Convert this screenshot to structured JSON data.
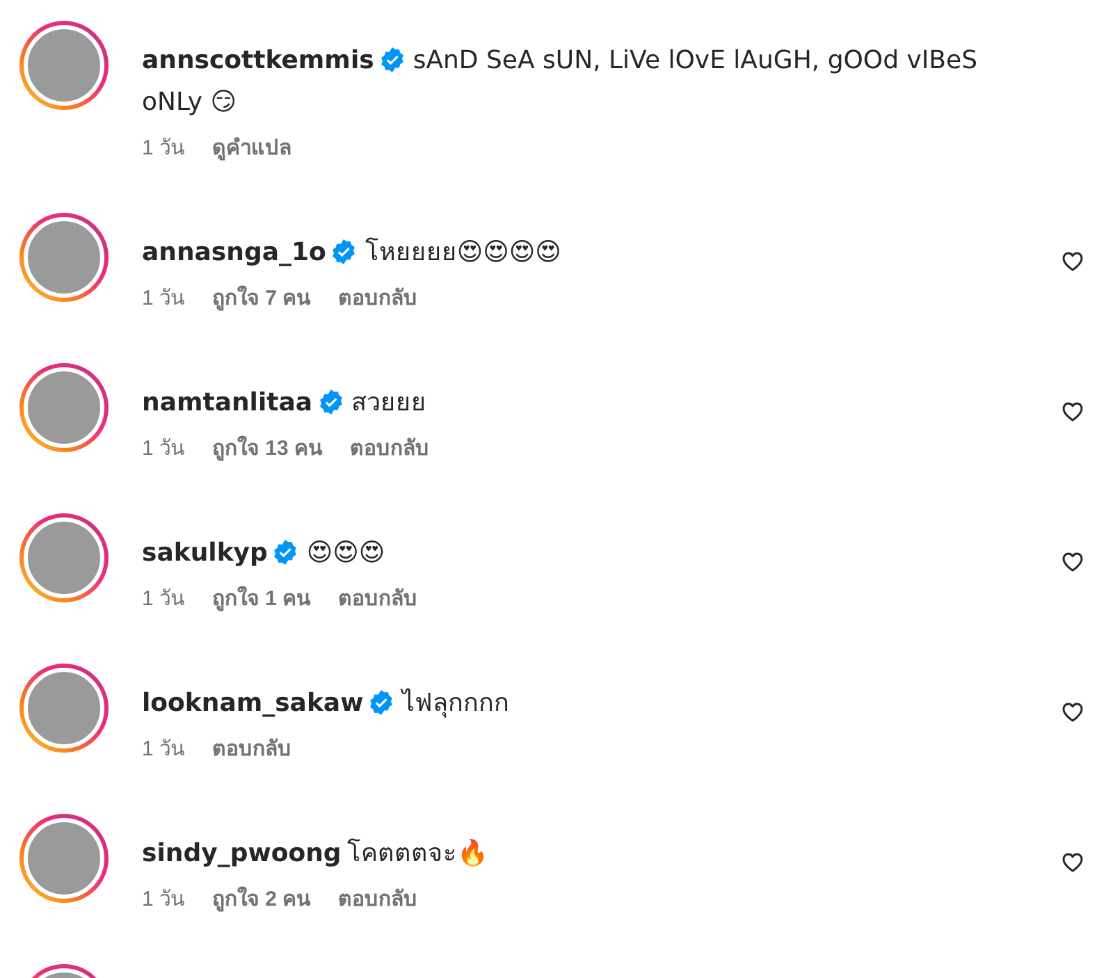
{
  "comments": [
    {
      "kind": "comment",
      "username": "annscottkemmis",
      "verified": true,
      "text": "sAnD SeA sUN, LiVe lOvE lAuGH, gOOd vIBeS oNLy 😏",
      "has_like": false,
      "meta": [
        {
          "kind": "time",
          "text": "1 วัน"
        },
        {
          "kind": "action",
          "text": "ดูคำแปล"
        }
      ]
    },
    {
      "kind": "comment",
      "username": "annasnga_1o",
      "verified": true,
      "text": "โหยยยย😍😍😍😍",
      "has_like": true,
      "liked": false,
      "meta": [
        {
          "kind": "time",
          "text": "1 วัน"
        },
        {
          "kind": "likes",
          "text": "ถูกใจ 7 คน"
        },
        {
          "kind": "action",
          "text": "ตอบกลับ"
        }
      ]
    },
    {
      "kind": "comment",
      "username": "namtanlitaa",
      "verified": true,
      "text": "สวยยย",
      "has_like": true,
      "liked": false,
      "meta": [
        {
          "kind": "time",
          "text": "1 วัน"
        },
        {
          "kind": "likes",
          "text": "ถูกใจ 13 คน"
        },
        {
          "kind": "action",
          "text": "ตอบกลับ"
        }
      ]
    },
    {
      "kind": "comment",
      "username": "sakulkyp",
      "verified": true,
      "text": "😍😍😍",
      "has_like": true,
      "liked": false,
      "meta": [
        {
          "kind": "time",
          "text": "1 วัน"
        },
        {
          "kind": "likes",
          "text": "ถูกใจ 1 คน"
        },
        {
          "kind": "action",
          "text": "ตอบกลับ"
        }
      ]
    },
    {
      "kind": "comment",
      "username": "looknam_sakaw",
      "verified": true,
      "text": "ไฟลุกกกก",
      "has_like": true,
      "liked": false,
      "meta": [
        {
          "kind": "time",
          "text": "1 วัน"
        },
        {
          "kind": "action",
          "text": "ตอบกลับ"
        }
      ]
    },
    {
      "kind": "comment",
      "username": "sindy_pwoong",
      "verified": false,
      "text": "โคตตตจะ🔥",
      "has_like": true,
      "liked": false,
      "meta": [
        {
          "kind": "time",
          "text": "1 วัน"
        },
        {
          "kind": "likes",
          "text": "ถูกใจ 2 คน"
        },
        {
          "kind": "action",
          "text": "ตอบกลับ"
        }
      ]
    },
    {
      "kind": "partial"
    }
  ]
}
